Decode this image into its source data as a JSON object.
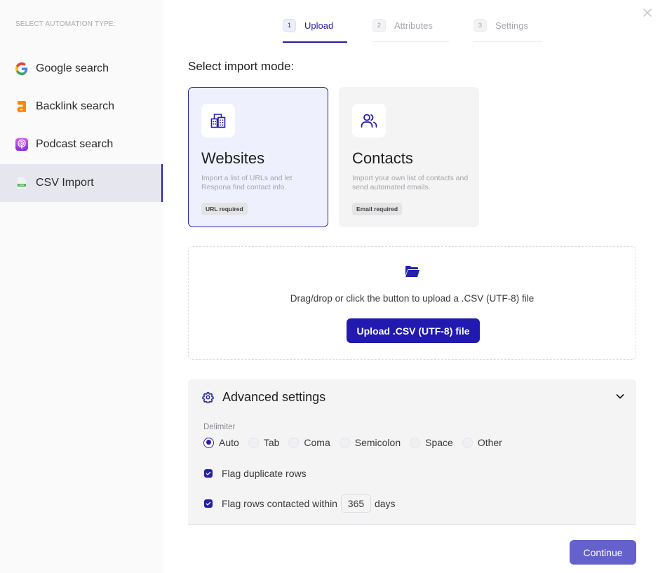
{
  "sidebar": {
    "title": "SELECT AUTOMATION TYPE:",
    "items": [
      {
        "label": "Google search",
        "icon": "google-icon",
        "active": false
      },
      {
        "label": "Backlink search",
        "icon": "ahrefs-icon",
        "active": false
      },
      {
        "label": "Podcast search",
        "icon": "podcast-icon",
        "active": false
      },
      {
        "label": "CSV Import",
        "icon": "csv-file-icon",
        "active": true
      }
    ]
  },
  "stepper": {
    "steps": [
      {
        "number": "1",
        "label": "Upload",
        "active": true
      },
      {
        "number": "2",
        "label": "Attributes",
        "active": false
      },
      {
        "number": "3",
        "label": "Settings",
        "active": false
      }
    ]
  },
  "import_mode": {
    "title": "Select import mode:",
    "options": [
      {
        "title": "Websites",
        "description": "Import a list of URLs and let Respona find contact info.",
        "badge": "URL required",
        "icon": "buildings-icon",
        "selected": true
      },
      {
        "title": "Contacts",
        "description": "Import your own list of contacts and send automated emails.",
        "badge": "Email required",
        "icon": "users-icon",
        "selected": false
      }
    ]
  },
  "dropzone": {
    "hint": "Drag/drop or click the button to upload a .CSV (UTF-8) file",
    "button_label": "Upload .CSV (UTF-8) file"
  },
  "advanced": {
    "title": "Advanced settings",
    "delimiter_label": "Delimiter",
    "delimiters": [
      "Auto",
      "Tab",
      "Coma",
      "Semicolon",
      "Space",
      "Other"
    ],
    "selected_delimiter": "Auto",
    "flag_duplicates_label": "Flag duplicate rows",
    "flag_duplicates_checked": true,
    "flag_contacted_prefix": "Flag rows contacted within",
    "flag_contacted_days": "365",
    "flag_contacted_suffix": "days",
    "flag_contacted_checked": true
  },
  "footer": {
    "continue_label": "Continue"
  },
  "colors": {
    "accent": "#251fa9",
    "continue": "#6461cd"
  }
}
